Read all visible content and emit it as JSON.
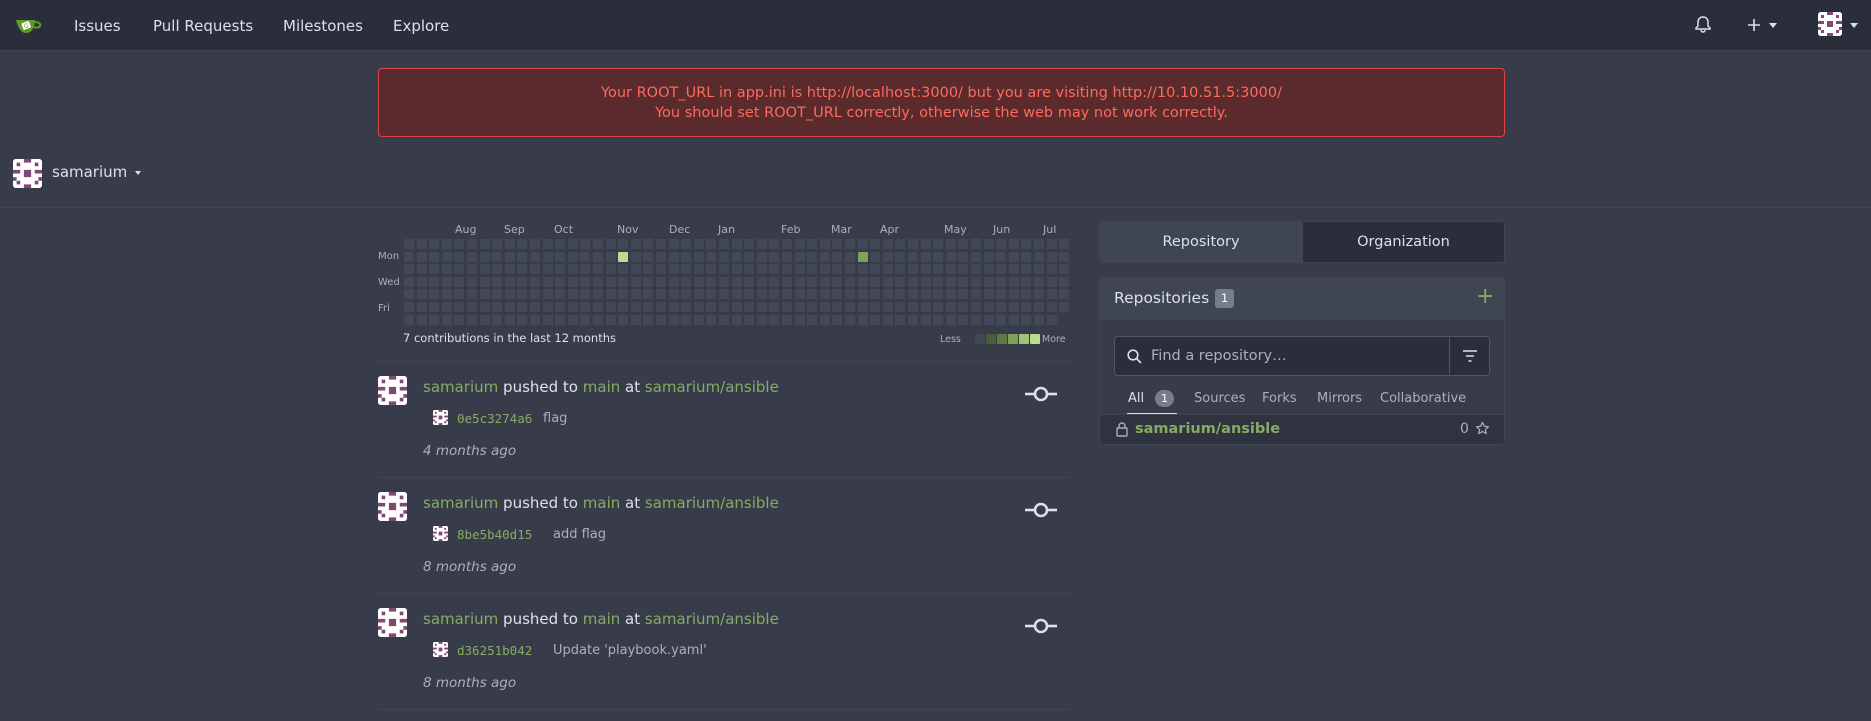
{
  "navbar": {
    "logo": "gitea-logo",
    "items": [
      "Issues",
      "Pull Requests",
      "Milestones",
      "Explore"
    ],
    "right_icons": [
      "bell-icon",
      "plus-icon",
      "avatar"
    ]
  },
  "warning": {
    "line1": "Your ROOT_URL in app.ini is http://localhost:3000/ but you are visiting http://10.10.51.5:3000/",
    "line2": "You should set ROOT_URL correctly, otherwise the web may not work correctly.",
    "colors": {
      "text": "#ff6a5c",
      "border": "#d94545",
      "background": "#5a2a2c"
    }
  },
  "user": {
    "name": "samarium"
  },
  "heatmap": {
    "months": [
      "Aug",
      "Sep",
      "Oct",
      "Nov",
      "Dec",
      "Jan",
      "Feb",
      "Mar",
      "Apr",
      "May",
      "Jun",
      "Jul"
    ],
    "days": [
      "Mon",
      "Wed",
      "Fri"
    ],
    "total_text": "7 contributions in the last 12 months",
    "legend_less": "Less",
    "legend_more": "More",
    "active_cells": [
      {
        "week": 17,
        "day": 1,
        "level": 4
      },
      {
        "week": 36,
        "day": 1,
        "level": 2
      }
    ],
    "colors": [
      "#434856",
      "#4a5e3a",
      "#5c7a45",
      "#7da35a",
      "#9fc477",
      "#b9dc92"
    ]
  },
  "feed": [
    {
      "user": "samarium",
      "action": "pushed to",
      "branch": "main",
      "at": "at",
      "repo": "samarium/ansible",
      "sha": "0e5c3274a6",
      "message": "flag",
      "time": "4 months ago"
    },
    {
      "user": "samarium",
      "action": "pushed to",
      "branch": "main",
      "at": "at",
      "repo": "samarium/ansible",
      "sha": "8be5b40d15",
      "message": "add flag",
      "time": "8 months ago"
    },
    {
      "user": "samarium",
      "action": "pushed to",
      "branch": "main",
      "at": "at",
      "repo": "samarium/ansible",
      "sha": "d36251b042",
      "message": "Update 'playbook.yaml'",
      "time": "8 months ago"
    }
  ],
  "right": {
    "tabs": [
      "Repository",
      "Organization"
    ],
    "repos_title": "Repositories",
    "repos_count": "1",
    "search_placeholder": "Find a repository…",
    "subtabs": [
      "All",
      "Sources",
      "Forks",
      "Mirrors",
      "Collaborative"
    ],
    "all_count": "1",
    "repo_list": [
      {
        "name": "samarium/ansible",
        "stars": "0"
      }
    ],
    "accent": "#87ab63"
  }
}
